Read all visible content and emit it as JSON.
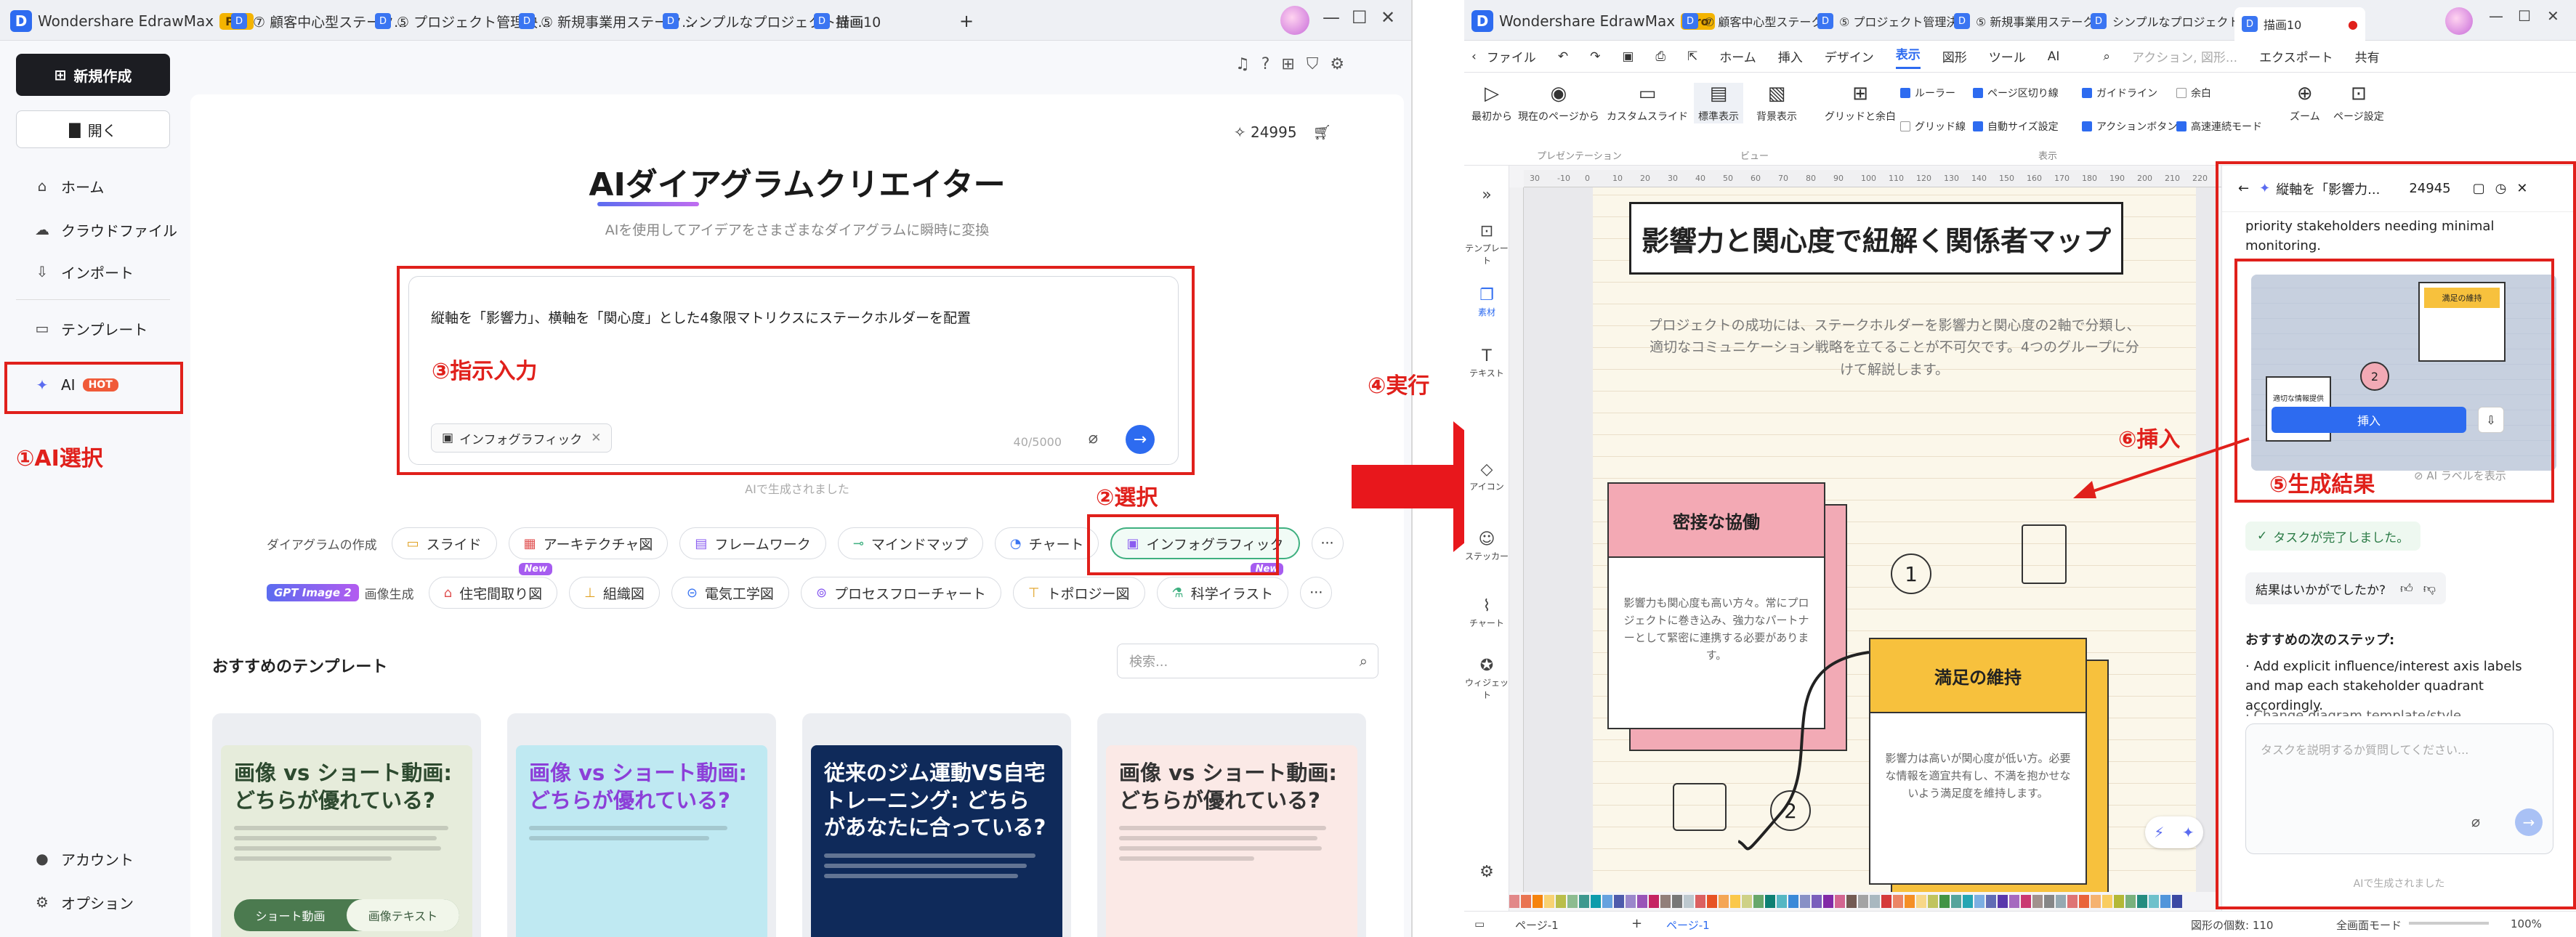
{
  "left_window": {
    "app_name": "Wondershare EdrawMax",
    "pro_badge": "Pro",
    "tabs": [
      "⑦ 顧客中心型ステーク...",
      "⑤ プロジェクト管理決...",
      "⑤ 新規事業用ステーク...",
      "シンプルなプロジェクト計画",
      "描画10"
    ],
    "new_tab_glyph": "+",
    "window_controls": [
      "—",
      "☐",
      "✕"
    ],
    "sidebar": {
      "new_button": "新規作成",
      "open_button": "開く",
      "items": [
        "ホーム",
        "クラウドファイル",
        "インポート",
        "テンプレート",
        "AI"
      ],
      "hot_badge": "HOT",
      "bottom_items": [
        "アカウント",
        "オプション"
      ]
    },
    "credits": "24995",
    "hero_title": "AIダイアグラムクリエイター",
    "hero_subtitle": "AIを使用してアイデアをさまざまなダイアグラムに瞬時に変換",
    "prompt_text": "縦軸を「影響力」、横軸を「関心度」とした4象限マトリクスにステークホルダーを配置",
    "prompt_chip": "インフォグラフィック",
    "char_counter": "40/5000",
    "ai_note": "AIで生成されました",
    "category_label": "ダイアグラムの作成",
    "categories": [
      "スライド",
      "アーキテクチャ図",
      "フレームワーク",
      "マインドマップ",
      "チャート",
      "インフォグラフィック"
    ],
    "selected_category": "インフォグラフィック",
    "gpt_badge": "GPT Image 2",
    "image_gen_label": "画像生成",
    "image_categories": [
      "住宅間取り図",
      "組織図",
      "電気工学図",
      "プロセスフローチャート",
      "トポロジー図",
      "科学イラスト"
    ],
    "new_tag": "New",
    "more_glyph": "···",
    "templates_title": "おすすめのテンプレート",
    "search_placeholder": "検索...",
    "template_cards": [
      {
        "title": "画像 vs ショート動画: どちらが優れている?",
        "tabs": [
          "ショート動画",
          "画像テキスト"
        ]
      },
      {
        "title": "画像 vs ショート動画: どちらが優れている?"
      },
      {
        "title": "従来のジム運動VS自宅トレーニング: どちらがあなたに合っている?"
      },
      {
        "title": "画像 vs ショート動画: どちらが優れている?"
      }
    ]
  },
  "annotations": {
    "step1": "①AI選択",
    "step2": "②選択",
    "step3": "③指示入力",
    "step4": "④実行",
    "step5": "⑤生成結果",
    "step6": "⑥挿入"
  },
  "right_window": {
    "app_name": "Wondershare EdrawMax",
    "pro_badge": "Pro",
    "tabs": [
      "⑦ 顧客中心型ステーク...",
      "⑤ プロジェクト管理決...",
      "⑤ 新規事業用ステーク...",
      "シンプルなプロジェクト計画",
      "描画10"
    ],
    "menu": [
      "ファイル",
      "ホーム",
      "挿入",
      "デザイン",
      "表示",
      "図形",
      "ツール",
      "AI"
    ],
    "active_menu": "表示",
    "menu_right": [
      "アクション, 図形...",
      "エクスポート",
      "共有"
    ],
    "ribbon_buttons": [
      "最初から",
      "現在のページから",
      "カスタムスライド",
      "標準表示",
      "背景表示",
      "グリッドと余白",
      "ズーム",
      "ページ設定"
    ],
    "ribbon_checks": [
      {
        "label": "ルーラー",
        "on": true
      },
      {
        "label": "ページ区切り線",
        "on": true
      },
      {
        "label": "ガイドライン",
        "on": true
      },
      {
        "label": "余白",
        "on": false
      },
      {
        "label": "グリッド線",
        "on": false
      },
      {
        "label": "自動サイズ設定",
        "on": true
      },
      {
        "label": "アクションボタン",
        "on": true
      },
      {
        "label": "高速連続モード",
        "on": true
      }
    ],
    "ribbon_groups": [
      "プレゼンテーション",
      "ビュー",
      "表示"
    ],
    "left_tools": [
      "テンプレート",
      "素材",
      "テキスト",
      "アイコン",
      "ステッカー",
      "チャート",
      "ウィジェット"
    ],
    "ruler_marks": [
      "30",
      "-10",
      "0",
      "10",
      "20",
      "30",
      "40",
      "50",
      "60",
      "70",
      "80",
      "90",
      "100",
      "110",
      "120",
      "130",
      "140",
      "150",
      "160",
      "170",
      "180",
      "190",
      "200",
      "210",
      "220"
    ],
    "canvas": {
      "title": "影響力と関心度で紐解く関係者マップ",
      "description": "プロジェクトの成功には、ステークホルダーを影響力と関心度の2軸で分類し、適切なコミュニケーション戦略を立てることが不可欠です。4つのグループに分けて解説します。",
      "quadrants": [
        {
          "num": "1",
          "title": "密接な協働",
          "body": "影響力も関心度も高い方々。常にプロジェクトに巻き込み、強力なパートナーとして緊密に連携する必要があります。"
        },
        {
          "num": "2",
          "title": "満足の維持",
          "body": "影響力は高いが関心度が低い方。必要な情報を適宜共有し、不満を抱かせないよう満足度を維持します。"
        }
      ]
    },
    "ai_panel": {
      "title": "縦軸を「影響力...",
      "credits": "24945",
      "intro": "priority stakeholders needing minimal monitoring.",
      "insert_button": "挿入",
      "ai_label": "AI ラベルを表示",
      "task_done": "タスクが完了しました。",
      "result_question": "結果はいかがでしたか?",
      "next_steps_title": "おすすめの次のステップ:",
      "next_steps": "· Add explicit influence/interest axis labels and map each stakeholder quadrant accordingly.",
      "next_steps_cut": "· Change diagram template/style",
      "chat_placeholder": "タスクを説明するか質問してください...",
      "ai_note": "AIで生成されました",
      "thumb_heading": "満足の維持",
      "thumb_card2": "適切な情報提供"
    },
    "status": {
      "page_label": "ページ-1",
      "page_tab": "ページ-1",
      "shape_count": "図形の個数: 110",
      "fullscreen": "全画面モード",
      "zoom": "100%"
    }
  }
}
